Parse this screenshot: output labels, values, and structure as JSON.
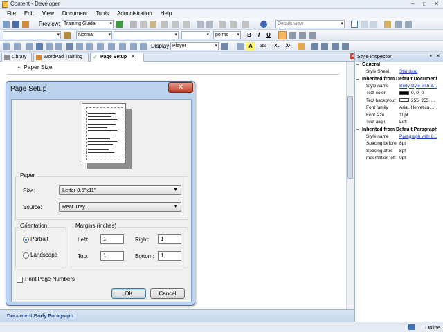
{
  "window": {
    "title": "Content - Developer"
  },
  "menu": [
    "File",
    "Edit",
    "View",
    "Document",
    "Tools",
    "Administration",
    "Help"
  ],
  "toolbar1": {
    "preview_label": "Preview:",
    "preview_value": "Training Guide",
    "view_value": "Details view"
  },
  "toolbar2": {
    "style_value": "Normal",
    "unit_value": "points",
    "bold": "B",
    "italic": "I",
    "underline": "U"
  },
  "toolbar3": {
    "display_label": "Display:",
    "display_value": "Player",
    "highlight": "A",
    "strike": "abc",
    "subscript": "X₂",
    "superscript": "X²"
  },
  "tabs": [
    {
      "label": "Library"
    },
    {
      "label": "WordPad Training"
    },
    {
      "label": "Page Setup"
    }
  ],
  "editor": {
    "bullet_text": "Paper Size"
  },
  "docbar": {
    "crumb1": "Document Body",
    "crumb2": "Paragraph"
  },
  "inspector": {
    "title": "Style Inspector",
    "sections": {
      "general": "General",
      "default_doc": "Inherited from Default Document",
      "default_para": "Inherited from Default Paragraph"
    },
    "rows": {
      "style_sheet": {
        "k": "Style Sheet",
        "v": "Standard"
      },
      "style_name1": {
        "k": "Style name",
        "v": "Body style with 8..."
      },
      "text_color": {
        "k": "Text color",
        "v": "0, 0, 0"
      },
      "text_bg": {
        "k": "Text backgrour",
        "v": "255, 255, ..."
      },
      "font_family": {
        "k": "Font family",
        "v": "Arial, Helvetica, ..."
      },
      "font_size": {
        "k": "Font size",
        "v": "10pt"
      },
      "text_align": {
        "k": "Text align",
        "v": "Left"
      },
      "style_name2": {
        "k": "Style name",
        "v": "Paragraph with 8..."
      },
      "spacing_before": {
        "k": "Spacing before",
        "v": "8pt"
      },
      "spacing_after": {
        "k": "Spacing after",
        "v": "8pt"
      },
      "indent_left": {
        "k": "Indentation left",
        "v": "0pt"
      }
    }
  },
  "status": {
    "online": "Online"
  },
  "dialog": {
    "title": "Page Setup",
    "close": "✕",
    "paper_group": "Paper",
    "size_label": "Size:",
    "size_value": "Letter 8.5\"x11\"",
    "source_label": "Source:",
    "source_value": "Rear Tray",
    "orientation_group": "Orientation",
    "portrait": "Portrait",
    "landscape": "Landscape",
    "margins_group": "Margins (inches)",
    "left_label": "Left:",
    "left_value": "1",
    "right_label": "Right:",
    "right_value": "1",
    "top_label": "Top:",
    "top_value": "1",
    "bottom_label": "Bottom:",
    "bottom_value": "1",
    "print_page_numbers": "Print Page Numbers",
    "ok": "OK",
    "cancel": "Cancel"
  },
  "colors": {
    "accent": "#3c7fb1",
    "link": "#1a3ccc",
    "close_red": "#c3402b"
  }
}
